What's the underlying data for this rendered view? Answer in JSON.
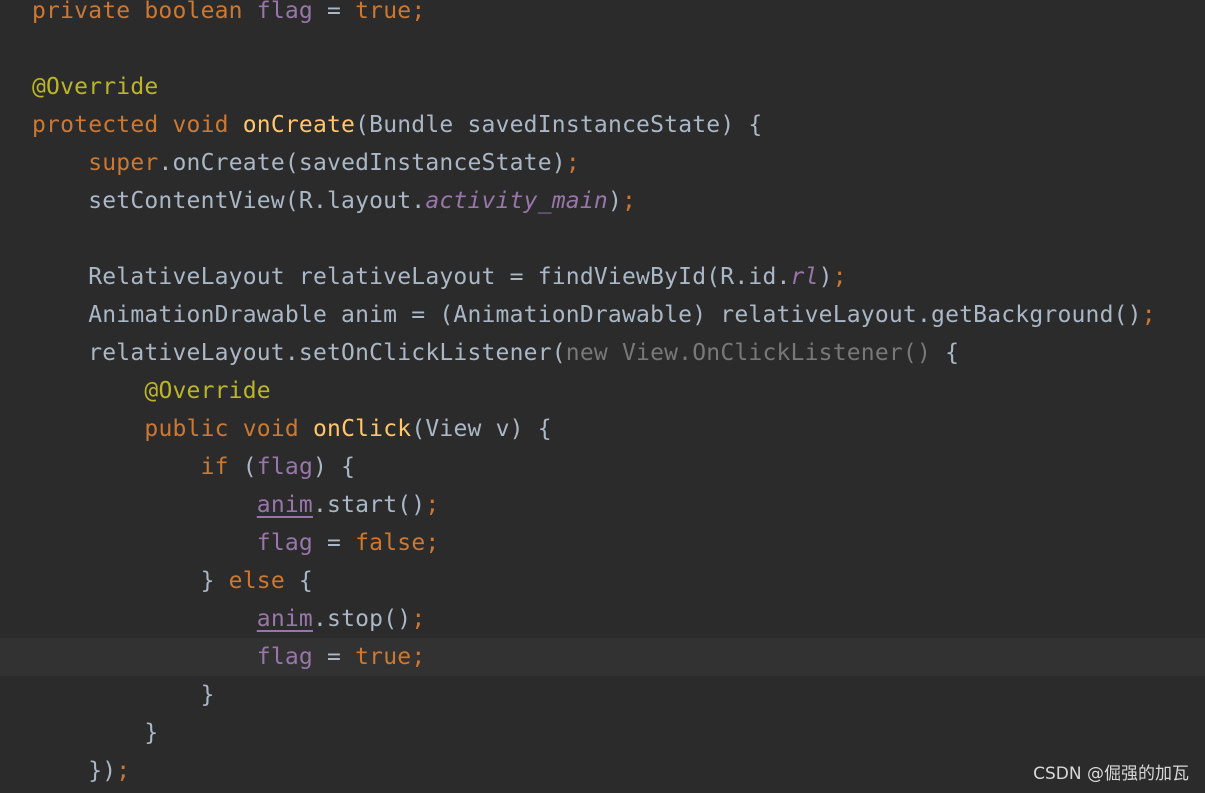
{
  "editor": {
    "theme_colors": {
      "background": "#2b2b2b",
      "current_line": "#323232",
      "keyword": "#cc7832",
      "field": "#9876aa",
      "annotation": "#bbb529",
      "method_declaration": "#ffc66d",
      "default_text": "#a9b7c6",
      "anonymous_class_folded": "#787878"
    },
    "current_line_index": 17,
    "lines": [
      {
        "tokens": [
          {
            "t": "private boolean ",
            "c": "k"
          },
          {
            "t": "flag",
            "c": "f"
          },
          {
            "t": " = ",
            "c": "t"
          },
          {
            "t": "true;",
            "c": "k"
          }
        ]
      },
      {
        "tokens": []
      },
      {
        "tokens": [
          {
            "t": "@Override",
            "c": "a"
          }
        ]
      },
      {
        "tokens": [
          {
            "t": "protected void ",
            "c": "k"
          },
          {
            "t": "onCreate",
            "c": "m"
          },
          {
            "t": "(Bundle savedInstanceState) {",
            "c": "t"
          }
        ]
      },
      {
        "tokens": [
          {
            "t": "    ",
            "c": "t"
          },
          {
            "t": "super",
            "c": "k"
          },
          {
            "t": ".onCreate(savedInstanceState)",
            "c": "t"
          },
          {
            "t": ";",
            "c": "k"
          }
        ]
      },
      {
        "tokens": [
          {
            "t": "    setContentView(R.layout.",
            "c": "t"
          },
          {
            "t": "activity_main",
            "c": "fi"
          },
          {
            "t": ")",
            "c": "t"
          },
          {
            "t": ";",
            "c": "k"
          }
        ]
      },
      {
        "tokens": []
      },
      {
        "tokens": [
          {
            "t": "    RelativeLayout relativeLayout = findViewById(R.id.",
            "c": "t"
          },
          {
            "t": "rl",
            "c": "fi"
          },
          {
            "t": ")",
            "c": "t"
          },
          {
            "t": ";",
            "c": "k"
          }
        ]
      },
      {
        "tokens": [
          {
            "t": "    AnimationDrawable anim = (AnimationDrawable) relativeLayout.getBackground()",
            "c": "t"
          },
          {
            "t": ";",
            "c": "k"
          }
        ]
      },
      {
        "tokens": [
          {
            "t": "    relativeLayout.setOnClickListener(",
            "c": "t"
          },
          {
            "t": "new View.OnClickListener()",
            "c": "g"
          },
          {
            "t": " {",
            "c": "t"
          }
        ]
      },
      {
        "tokens": [
          {
            "t": "        ",
            "c": "t"
          },
          {
            "t": "@Override",
            "c": "a"
          }
        ]
      },
      {
        "tokens": [
          {
            "t": "        ",
            "c": "t"
          },
          {
            "t": "public void ",
            "c": "k"
          },
          {
            "t": "onClick",
            "c": "m"
          },
          {
            "t": "(View v) {",
            "c": "t"
          }
        ]
      },
      {
        "tokens": [
          {
            "t": "            ",
            "c": "t"
          },
          {
            "t": "if ",
            "c": "k"
          },
          {
            "t": "(",
            "c": "t"
          },
          {
            "t": "flag",
            "c": "f"
          },
          {
            "t": ") {",
            "c": "t"
          }
        ]
      },
      {
        "tokens": [
          {
            "t": "                ",
            "c": "t"
          },
          {
            "t": "anim",
            "c": "u"
          },
          {
            "t": ".start()",
            "c": "t"
          },
          {
            "t": ";",
            "c": "k"
          }
        ]
      },
      {
        "tokens": [
          {
            "t": "                ",
            "c": "t"
          },
          {
            "t": "flag",
            "c": "f"
          },
          {
            "t": " = ",
            "c": "t"
          },
          {
            "t": "false;",
            "c": "k"
          }
        ]
      },
      {
        "tokens": [
          {
            "t": "            } ",
            "c": "t"
          },
          {
            "t": "else ",
            "c": "k"
          },
          {
            "t": "{",
            "c": "t"
          }
        ]
      },
      {
        "tokens": [
          {
            "t": "                ",
            "c": "t"
          },
          {
            "t": "anim",
            "c": "u"
          },
          {
            "t": ".stop()",
            "c": "t"
          },
          {
            "t": ";",
            "c": "k"
          }
        ]
      },
      {
        "tokens": [
          {
            "t": "                ",
            "c": "t"
          },
          {
            "t": "flag",
            "c": "f"
          },
          {
            "t": " = ",
            "c": "t"
          },
          {
            "t": "true;",
            "c": "k"
          }
        ]
      },
      {
        "tokens": [
          {
            "t": "            }",
            "c": "t"
          }
        ]
      },
      {
        "tokens": [
          {
            "t": "        }",
            "c": "t"
          }
        ]
      },
      {
        "tokens": [
          {
            "t": "    })",
            "c": "t"
          },
          {
            "t": ";",
            "c": "k"
          }
        ]
      }
    ]
  },
  "watermark": {
    "text": "CSDN @倔强的加瓦"
  }
}
